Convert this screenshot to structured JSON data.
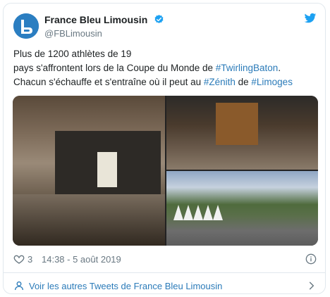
{
  "account": {
    "display_name": "France Bleu Limousin",
    "handle": "@FBLimousin"
  },
  "tweet": {
    "line1": "Plus de 1200 athlètes de 19",
    "line2_pre": "pays s'affrontent lors de la Coupe du Monde de ",
    "line2_tag": "#TwirlingBaton",
    "line2_post": ".",
    "line3_pre": "Chacun s'échauffe et s'entraîne où il peut au ",
    "line3_tag1": "#Zénith",
    "line3_mid": " de ",
    "line3_tag2": "#Limoges"
  },
  "footer": {
    "likes": "3",
    "timestamp": "14:38 - 5 août 2019"
  },
  "more_link": {
    "label": "Voir les autres Tweets de France Bleu Limousin"
  },
  "icons": {
    "avatar": "france-bleu-logo-icon",
    "verified": "verified-badge-icon",
    "brand": "twitter-bird-icon",
    "like": "heart-icon",
    "info": "info-icon",
    "more": "person-icon",
    "chevron": "chevron-right-icon"
  },
  "colors": {
    "link": "#2b7bb9",
    "muted": "#697882",
    "text": "#1c2022",
    "verified": "#1da1f2",
    "twitter": "#1da1f2"
  }
}
